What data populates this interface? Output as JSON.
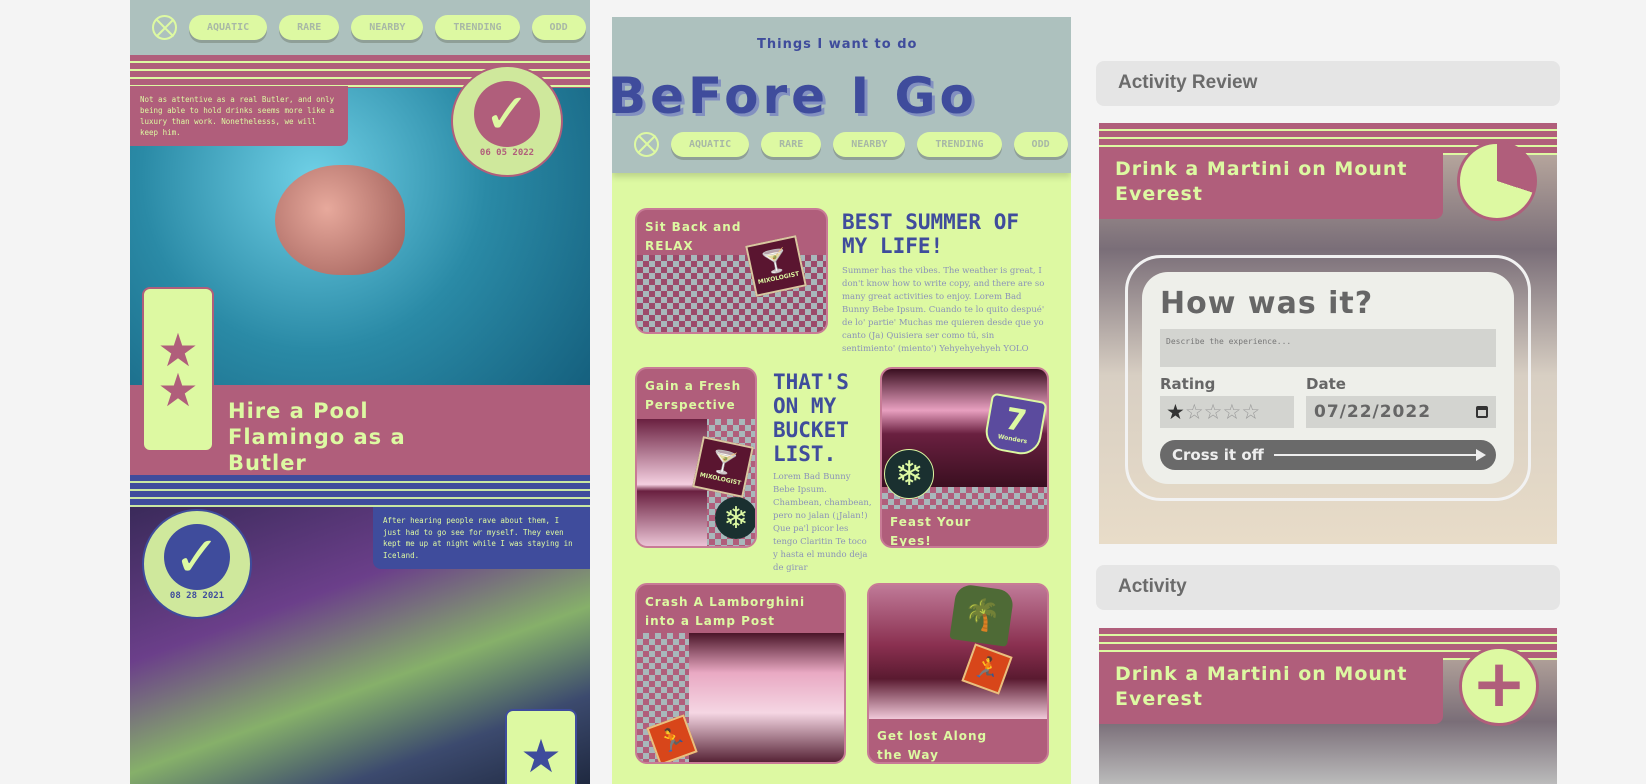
{
  "nav": {
    "pills": [
      "AQUATIC",
      "RARE",
      "NEARBY",
      "TRENDING",
      "ODD"
    ]
  },
  "left": {
    "flamingo": {
      "caption": "Not as attentive as a real Butler, and only being able to hold drinks seems more like a luxury than work. Nonethelesss, we will keep him.",
      "date": "06 05 2022",
      "title": "Hire a Pool Flamingo as a Butler"
    },
    "aurora": {
      "caption": "After hearing people rave about them, I just had to go see for myself. They even kept me up at night while I was staying in Iceland.",
      "date": "08 28 2021"
    }
  },
  "middle": {
    "subtitle": "Things I want to do",
    "title": "BeFore I Go",
    "cards": [
      {
        "title": "Sit Back and RELAX",
        "sticker": "MIXOLOGIST"
      },
      {
        "title": "Gain a Fresh Perspective",
        "sticker": "MIXOLOGIST"
      },
      {
        "title": "Feast Your Eyes!",
        "sticker": "7",
        "sticker_sub": "Wonders"
      },
      {
        "title": "Crash A Lamborghini into a Lamp Post"
      },
      {
        "title": "Get lost Along the Way"
      }
    ],
    "blurb1": {
      "heading": "BEST SUMMER OF MY LIFE!",
      "body": "Summer has the vibes. The weather is great, I don't know how to write copy, and there are so many great activities to enjoy. Lorem Bad Bunny Bebe Ipsum. Cuando te lo quito despué' de lo' partie' Muchas me quieren desde que yo canto (Ja) Quisiera ser como tú, sin sentimiento' (miento') Yehyehyehyeh YOLO"
    },
    "blurb2": {
      "heading": "THAT'S ON MY BUCKET LIST.",
      "body": "Lorem Bad Bunny Bebe Ipsum. Chambean, chambean, pero no jalan (¡Jalan!) Que pa'l picor les tengo Claritin Te toco y hasta el mundo deja de girar"
    }
  },
  "right": {
    "review_header": "Activity Review",
    "activity_header": "Activity",
    "review": {
      "title": "Drink a Martini on Mount Everest",
      "progress": 0.3,
      "form_title": "How was it?",
      "placeholder": "Describe the experience...",
      "rating_label": "Rating",
      "rating": 1,
      "rating_max": 5,
      "date_label": "Date",
      "date": "07/22/2022",
      "button": "Cross it off"
    },
    "activity": {
      "title": "Drink a Martini on Mount Everest"
    }
  },
  "colors": {
    "pink": "#b05e7b",
    "lime": "#ddf9a2",
    "blue": "#3f4c9c",
    "gray": "#adc1be"
  }
}
